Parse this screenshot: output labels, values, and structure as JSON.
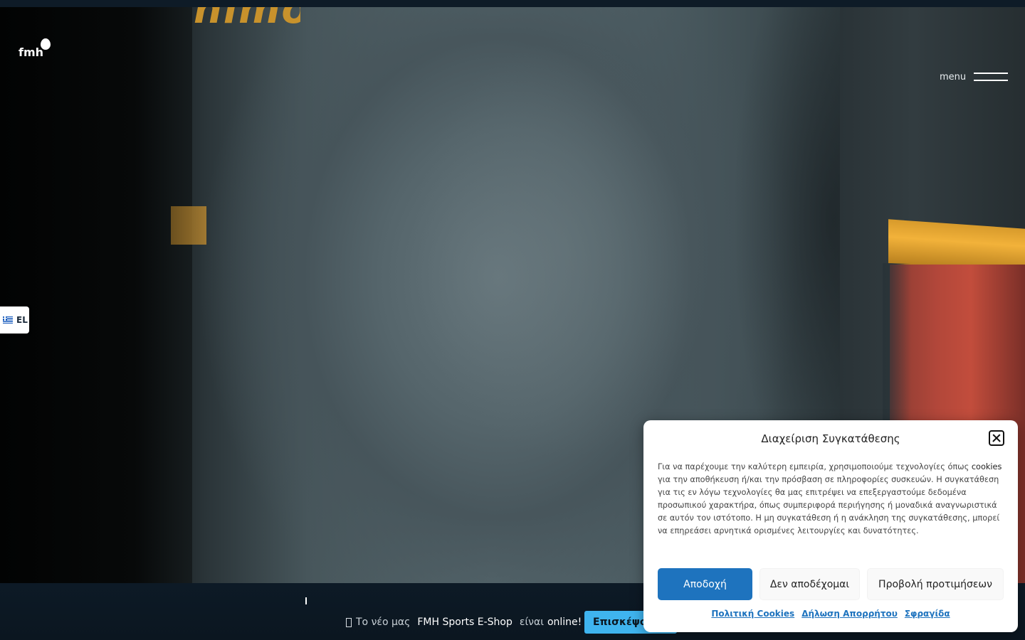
{
  "logo": {
    "text": "fmh"
  },
  "menu": {
    "label": "menu"
  },
  "language": {
    "code": "EL"
  },
  "hero": {
    "chest_text": "nimo"
  },
  "announcement": {
    "prefix": "Το νέο μας",
    "shop_name": "FMH Sports E-Shop",
    "suffix": "είναι",
    "status": "online!",
    "button_label": "Επισκέψου"
  },
  "consent": {
    "title": "Διαχείριση Συγκατάθεσης",
    "body_part1": "Για να παρέχουμε την καλύτερη εμπειρία, χρησιμοποιούμε τεχνολογίες όπως",
    "body_cookies": "cookies",
    "body_part2": "για την αποθήκευση ή/και την πρόσβαση σε πληροφορίες συσκευών. Η συγκατάθεση για τις εν λόγω τεχνολογίες θα μας επιτρέψει να επεξεργαστούμε δεδομένα προσωπικού χαρακτήρα, όπως συμπεριφορά περιήγησης ή μοναδικά αναγνωριστικά σε αυτόν τον ιστότοπο. Η μη συγκατάθεση ή η ανάκληση της συγκατάθεσης, μπορεί να επηρεάσει αρνητικά ορισμένες λειτουργίες και δυνατότητες.",
    "accept_label": "Αποδοχή",
    "deny_label": "Δεν αποδέχομαι",
    "prefs_label": "Προβολή προτιμήσεων",
    "links": [
      "Πολιτική Cookies",
      "Δήλωση Απορρήτου",
      "Σφραγίδα"
    ]
  },
  "colors": {
    "accent_blue": "#1e73be",
    "visit_button": "#3fb4ef",
    "dark_bg": "#0b1620"
  },
  "icons": {
    "close": "close-icon",
    "menu": "hamburger-icon",
    "flag": "greek-flag-icon"
  }
}
